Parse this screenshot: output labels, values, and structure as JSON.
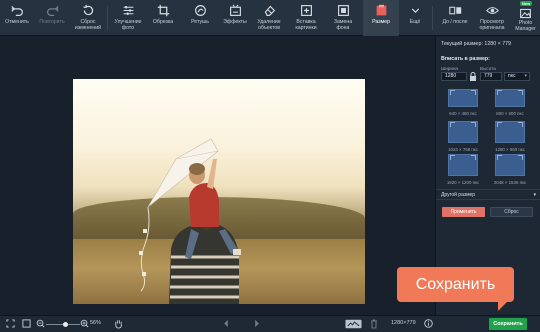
{
  "toolbar": {
    "undo": "Отменить",
    "redo": "Повторить",
    "reset_changes": "Сброс\nизменений",
    "enhance_photo": "Улучшение\nфото",
    "crop": "Обрезка",
    "retouch": "Ретушь",
    "effects": "Эффекты",
    "remove_objects": "Удаление\nобъектов",
    "insert_picture": "Вставка\nкартинки",
    "replace_background": "Замена\nфона",
    "resize": "Размер",
    "more": "Ещё",
    "before_after": "До / после",
    "view_original": "Просмотр\nоригинала",
    "photo_manager": "Photo\nManager",
    "new_badge": "New"
  },
  "panel": {
    "current_size": "Текущий размер: 1280 × 779",
    "fit_title": "Вписать в размер:",
    "width_label": "Ширина",
    "height_label": "Высота",
    "width_value": "1280",
    "height_value": "779",
    "unit": "пкс",
    "presets": [
      "640 × 480 пкс",
      "800 × 600 пкс",
      "1024 × 768 пкс",
      "1280 × 960 пкс",
      "1920 × 1200 пкс",
      "2048 × 1536 пкс"
    ],
    "other_size": "Другой размер",
    "apply": "Применить",
    "reset": "Сброс"
  },
  "bottom": {
    "zoom": "56%",
    "zoom_level": 0.56,
    "dimensions": "1280×779",
    "save": "Сохранить"
  },
  "callout": {
    "text": "Сохранить"
  },
  "colors": {
    "accent_save": "#1fa34a",
    "accent_apply": "#e07367",
    "callout": "#f07a58",
    "toolbar_bg": "#263240",
    "canvas_bg": "#17202b"
  }
}
